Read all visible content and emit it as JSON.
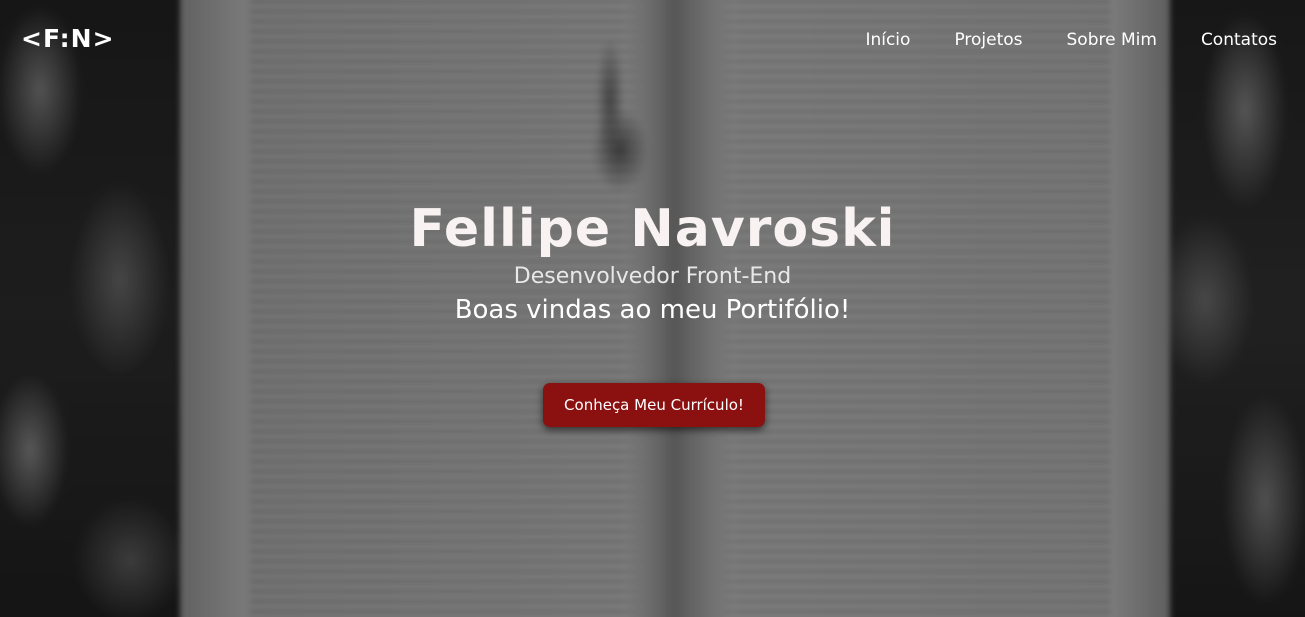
{
  "header": {
    "logo_text": "<F:N>",
    "nav": [
      {
        "label": "Início"
      },
      {
        "label": "Projetos"
      },
      {
        "label": "Sobre Mim"
      },
      {
        "label": "Contatos"
      }
    ]
  },
  "hero": {
    "name": "Fellipe Navroski",
    "role": "Desenvolvedor Front-End",
    "welcome": "Boas vindas ao meu Portifólio!",
    "cta_label": "Conheça Meu Currículo!"
  },
  "colors": {
    "cta_background": "#8b1111",
    "text": "#ffffff"
  }
}
